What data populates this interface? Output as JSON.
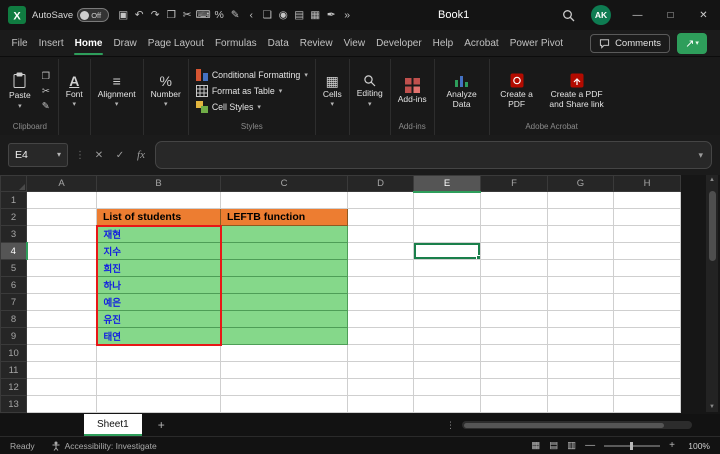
{
  "theme": {
    "accent_green": "#2E9E5B",
    "selection_green": "#1A7F4B",
    "orange_fill": "#ED7D31",
    "green_fill": "#85D88A",
    "blue_text": "#1420E0",
    "red_border": "#E81717"
  },
  "title_bar": {
    "autosave_label": "AutoSave",
    "autosave_state": "Off",
    "document_title": "Book1",
    "avatar_initials": "AK",
    "quick_access": [
      {
        "name": "save-icon",
        "glyph": "▣"
      },
      {
        "name": "undo-icon",
        "glyph": "↶"
      },
      {
        "name": "redo-icon",
        "glyph": "↷"
      },
      {
        "name": "copy-icon",
        "glyph": "❐"
      },
      {
        "name": "cut-icon",
        "glyph": "✂"
      },
      {
        "name": "keyboard-icon",
        "glyph": "⌨"
      },
      {
        "name": "percent-icon",
        "glyph": "%"
      },
      {
        "name": "format-painter-icon",
        "glyph": "✎"
      },
      {
        "name": "collapse-icon",
        "glyph": "‹"
      },
      {
        "name": "new-file-icon",
        "glyph": "❏"
      },
      {
        "name": "pin-icon",
        "glyph": "◉"
      },
      {
        "name": "camera-icon",
        "glyph": "▤"
      },
      {
        "name": "calculator-icon",
        "glyph": "▦"
      },
      {
        "name": "pen-icon",
        "glyph": "✒"
      },
      {
        "name": "more-icon",
        "glyph": "»"
      }
    ]
  },
  "ribbon": {
    "active_tab": "Home",
    "tabs": [
      "File",
      "Insert",
      "Home",
      "Draw",
      "Page Layout",
      "Formulas",
      "Data",
      "Review",
      "View",
      "Developer",
      "Help",
      "Acrobat",
      "Power Pivot"
    ],
    "comments_label": "Comments",
    "clipboard": {
      "group_label": "Clipboard",
      "paste_label": "Paste"
    },
    "font_label": "Font",
    "alignment_label": "Alignment",
    "number_label": "Number",
    "styles": {
      "group_label": "Styles",
      "conditional": "Conditional Formatting",
      "format_table": "Format as Table",
      "cell_styles": "Cell Styles"
    },
    "cells_label": "Cells",
    "editing_label": "Editing",
    "addins": {
      "group_label": "Add-ins",
      "button_label": "Add-ins"
    },
    "analyze_label": "Analyze Data",
    "acrobat": {
      "group_label": "Adobe Acrobat",
      "create_pdf": "Create a PDF",
      "share_link": "Create a PDF and Share link"
    }
  },
  "formula_bar": {
    "name_box": "E4",
    "formula": ""
  },
  "spreadsheet": {
    "columns": [
      "A",
      "B",
      "C",
      "D",
      "E",
      "F",
      "G",
      "H"
    ],
    "rows": [
      "1",
      "2",
      "3",
      "4",
      "5",
      "6",
      "7",
      "8",
      "9",
      "10",
      "11",
      "12",
      "13"
    ],
    "selected_cell": "E4",
    "selected_column": "E",
    "selected_row": 4,
    "headers": [
      {
        "cell": "B2",
        "text": "List of students"
      },
      {
        "cell": "C2",
        "text": "LEFTB function"
      }
    ],
    "students": [
      "재현",
      "지수",
      "희진",
      "하나",
      "예은",
      "유진",
      "태연"
    ],
    "student_column": "B",
    "function_column": "C",
    "data_row_start": 3,
    "data_row_end": 9
  },
  "sheet_bar": {
    "active_sheet": "Sheet1",
    "add_sheet_glyph": "+"
  },
  "status_bar": {
    "ready_label": "Ready",
    "accessibility_label": "Accessibility: Investigate",
    "zoom_percent": "100%"
  },
  "icons": {
    "chevron_down": "▾",
    "dots_vertical": "⋮",
    "minimize": "—",
    "maximize": "□",
    "close": "✕",
    "cancel": "✕",
    "check": "✓",
    "fx": "fx",
    "copy_glyph": "❐",
    "cut_glyph": "✂",
    "brush_glyph": "✎",
    "share_arrow": "↗",
    "up_arrow": "▲",
    "down_arrow": "▼",
    "view_normal": "▦",
    "view_layout": "▤",
    "view_break": "▥",
    "zoom_minus": "—",
    "zoom_plus": "+",
    "font_glyph": "A",
    "align_glyph": "≡",
    "percent_glyph": "%",
    "cells_glyph": "▦"
  }
}
